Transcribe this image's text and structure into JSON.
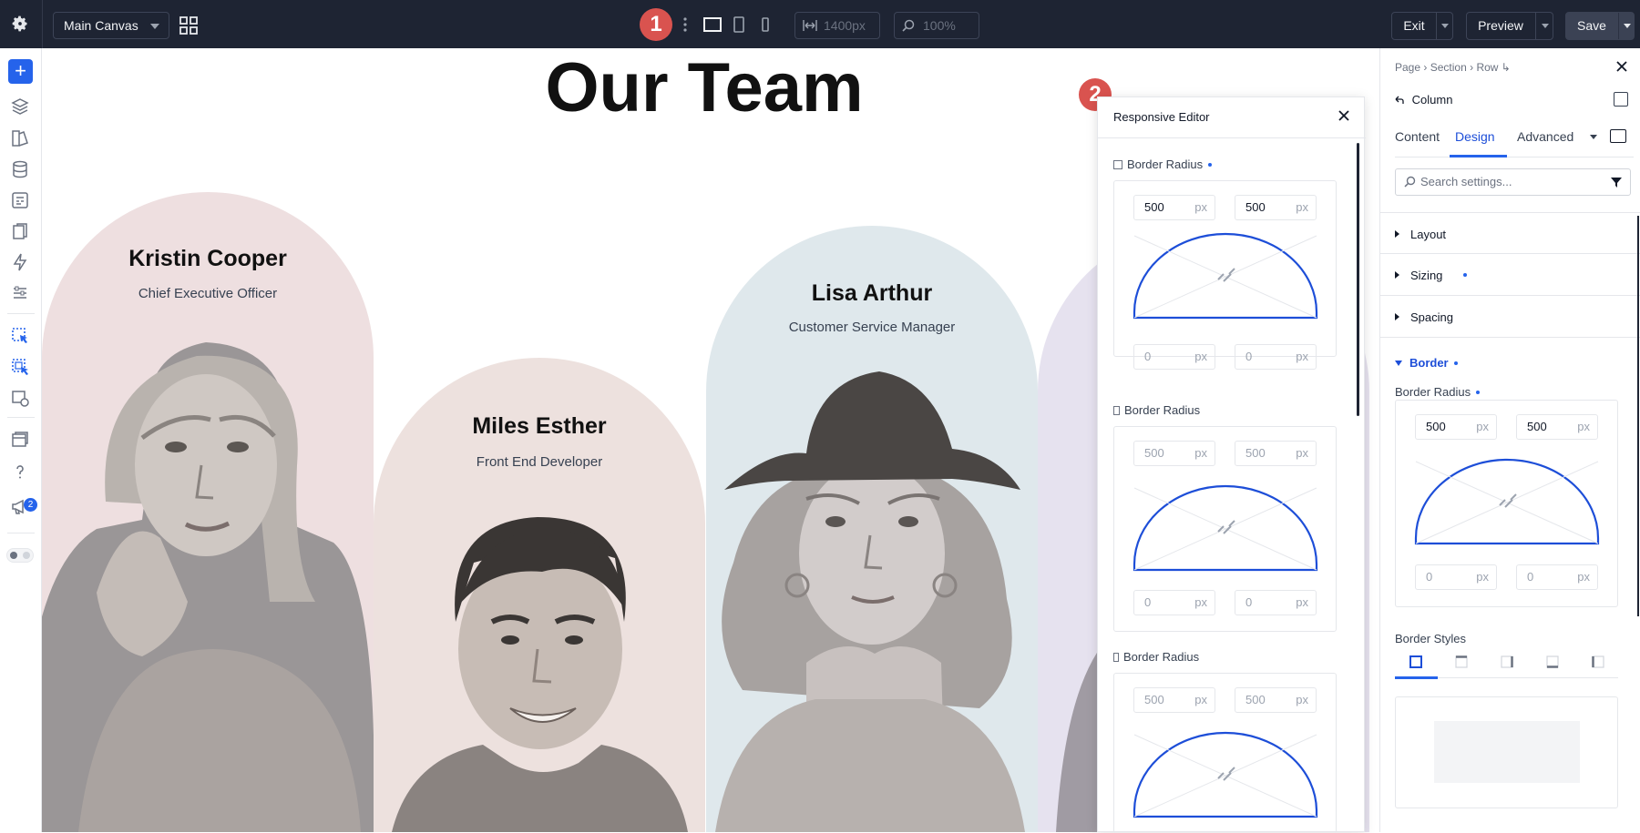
{
  "topbar": {
    "canvas_select": "Main Canvas",
    "step_badge": "1",
    "width_value": "1400px",
    "zoom_value": "100%",
    "exit_label": "Exit",
    "preview_label": "Preview",
    "save_label": "Save"
  },
  "leftrail": {
    "notifications_count": "2"
  },
  "canvas": {
    "title": "Our Team",
    "cards": [
      {
        "name": "Kristin Cooper",
        "role": "Chief Executive Officer",
        "bg": "#eedfe0"
      },
      {
        "name": "Miles Esther",
        "role": "Front End Developer",
        "bg": "#ede1de"
      },
      {
        "name": "Lisa Arthur",
        "role": "Customer Service Manager",
        "bg": "#dfe8ec"
      },
      {
        "name": "",
        "role": "",
        "bg": "#e6e2ef"
      }
    ]
  },
  "responsive_editor": {
    "step_badge": "2",
    "title": "Responsive Editor",
    "sections": [
      {
        "label": "Border Radius",
        "device": "desktop",
        "top_left": "500",
        "top_right": "500",
        "bottom_left": "0",
        "bottom_right": "0",
        "unit": "px"
      },
      {
        "label": "Border Radius",
        "device": "tablet",
        "top_left": "500",
        "top_right": "500",
        "bottom_left": "0",
        "bottom_right": "0",
        "unit": "px"
      },
      {
        "label": "Border Radius",
        "device": "phone",
        "top_left": "500",
        "top_right": "500",
        "unit": "px"
      }
    ]
  },
  "settings": {
    "breadcrumb": [
      "Page",
      "Section",
      "Row"
    ],
    "element": "Column",
    "tabs": [
      "Content",
      "Design",
      "Advanced"
    ],
    "active_tab": "Design",
    "search_placeholder": "Search settings...",
    "groups": [
      "Layout",
      "Sizing",
      "Spacing"
    ],
    "border_group": "Border",
    "border_radius_label": "Border Radius",
    "radius": {
      "top_left": "500",
      "top_right": "500",
      "bottom_left": "0",
      "bottom_right": "0",
      "unit": "px"
    },
    "border_styles_label": "Border Styles"
  },
  "colors": {
    "accent": "#2563eb",
    "topbar": "#1e2433",
    "badge": "#d9534f"
  }
}
